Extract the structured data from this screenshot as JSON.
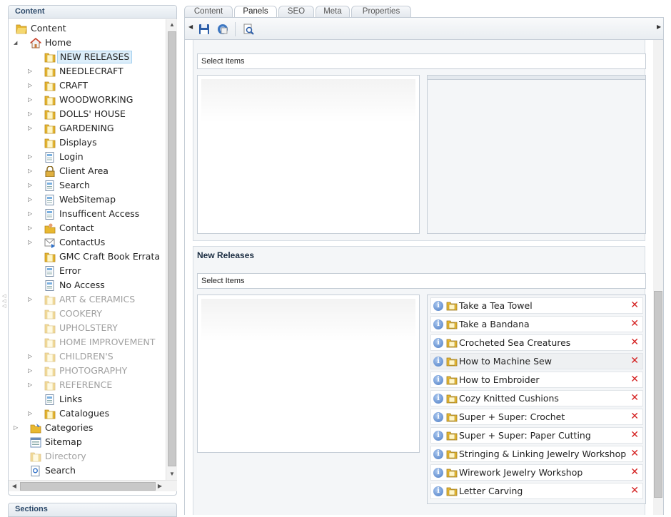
{
  "left_panel": {
    "title": "Content",
    "tree": [
      {
        "label": "Content",
        "icon": "folder-open-icon",
        "expander": "none",
        "depth": 0
      },
      {
        "label": "Home",
        "icon": "home-icon",
        "expander": "open",
        "depth": 1
      },
      {
        "label": "NEW RELEASES",
        "icon": "folder-icon",
        "expander": "none",
        "depth": 2,
        "selected": true
      },
      {
        "label": "NEEDLECRAFT",
        "icon": "folder-icon",
        "expander": "closed",
        "depth": 2
      },
      {
        "label": "CRAFT",
        "icon": "folder-icon",
        "expander": "closed",
        "depth": 2
      },
      {
        "label": "WOODWORKING",
        "icon": "folder-icon",
        "expander": "closed",
        "depth": 2
      },
      {
        "label": "DOLLS' HOUSE",
        "icon": "folder-icon",
        "expander": "closed",
        "depth": 2
      },
      {
        "label": "GARDENING",
        "icon": "folder-icon",
        "expander": "closed",
        "depth": 2
      },
      {
        "label": "Displays",
        "icon": "folder-icon",
        "expander": "none",
        "depth": 2
      },
      {
        "label": "Login",
        "icon": "page-icon",
        "expander": "closed",
        "depth": 2
      },
      {
        "label": "Client Area",
        "icon": "lock-icon",
        "expander": "closed",
        "depth": 2
      },
      {
        "label": "Search",
        "icon": "page-icon",
        "expander": "closed",
        "depth": 2
      },
      {
        "label": "WebSitemap",
        "icon": "page-icon",
        "expander": "closed",
        "depth": 2
      },
      {
        "label": "Insufficent Access",
        "icon": "page-icon",
        "expander": "closed",
        "depth": 2
      },
      {
        "label": "Contact",
        "icon": "contact-icon",
        "expander": "closed",
        "depth": 2
      },
      {
        "label": "ContactUs",
        "icon": "envelope-icon",
        "expander": "closed",
        "depth": 2
      },
      {
        "label": "GMC Craft Book Errata",
        "icon": "folder-icon",
        "expander": "none",
        "depth": 2
      },
      {
        "label": "Error",
        "icon": "page-icon",
        "expander": "none",
        "depth": 2
      },
      {
        "label": "No Access",
        "icon": "page-icon",
        "expander": "none",
        "depth": 2
      },
      {
        "label": "ART & CERAMICS",
        "icon": "folder-icon",
        "expander": "closed",
        "depth": 2,
        "dim": true
      },
      {
        "label": "COOKERY",
        "icon": "folder-icon",
        "expander": "none",
        "depth": 2,
        "dim": true
      },
      {
        "label": "UPHOLSTERY",
        "icon": "folder-icon",
        "expander": "none",
        "depth": 2,
        "dim": true
      },
      {
        "label": "HOME IMPROVEMENT",
        "icon": "folder-icon",
        "expander": "none",
        "depth": 2,
        "dim": true
      },
      {
        "label": "CHILDREN'S",
        "icon": "folder-icon",
        "expander": "closed",
        "depth": 2,
        "dim": true
      },
      {
        "label": "PHOTOGRAPHY",
        "icon": "folder-icon",
        "expander": "closed",
        "depth": 2,
        "dim": true
      },
      {
        "label": "REFERENCE",
        "icon": "folder-icon",
        "expander": "closed",
        "depth": 2,
        "dim": true
      },
      {
        "label": "Links",
        "icon": "page-icon",
        "expander": "none",
        "depth": 2
      },
      {
        "label": "Catalogues",
        "icon": "folder-icon",
        "expander": "closed",
        "depth": 2
      },
      {
        "label": "Categories",
        "icon": "categories-icon",
        "expander": "closed",
        "depth": 1
      },
      {
        "label": "Sitemap",
        "icon": "sitemap-icon",
        "expander": "none",
        "depth": 1
      },
      {
        "label": "Directory",
        "icon": "folder-icon",
        "expander": "none",
        "depth": 1,
        "dim": true
      },
      {
        "label": "Search",
        "icon": "search-page-icon",
        "expander": "none",
        "depth": 1
      }
    ]
  },
  "sections_panel": {
    "title": "Sections"
  },
  "tabs": [
    {
      "label": "Content"
    },
    {
      "label": "Panels",
      "active": true
    },
    {
      "label": "SEO"
    },
    {
      "label": "Meta"
    },
    {
      "label": "Properties"
    }
  ],
  "toolbar": {
    "buttons": [
      "save-icon",
      "publish-icon",
      "preview-icon"
    ]
  },
  "panels": [
    {
      "title": "",
      "select_label": "Select Items",
      "items": []
    },
    {
      "title": "New Releases",
      "select_label": "Select Items",
      "items": [
        "Take a Tea Towel",
        "Take a Bandana",
        "Crocheted Sea Creatures",
        "How to Machine Sew",
        "How to Embroider",
        "Cozy Knitted Cushions",
        "Super + Super: Crochet",
        "Super + Super: Paper Cutting",
        "Stringing & Linking Jewelry Workshop",
        "Wirework Jewelry Workshop",
        "Letter Carving"
      ]
    }
  ],
  "colors": {
    "accent": "#2d4a6a",
    "border": "#c5cdd6",
    "delete": "#d42020",
    "selected_bg": "#dceefa"
  }
}
